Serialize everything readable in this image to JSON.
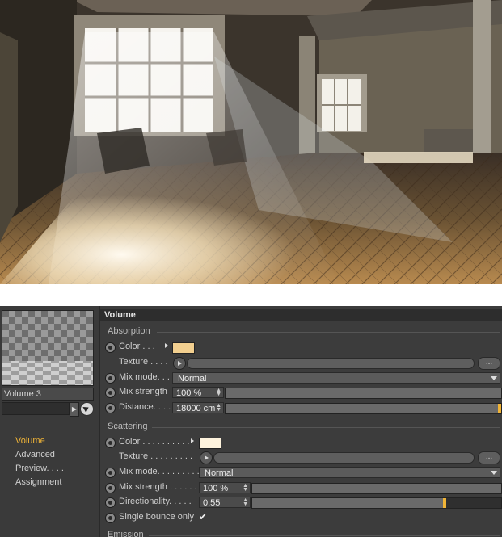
{
  "panel": {
    "material_name": "Volume 3",
    "nav": [
      "Volume",
      "Advanced",
      "Preview. . . .",
      "Assignment"
    ],
    "header": "Volume",
    "absorption": {
      "title": "Absorption",
      "color_label": "Color . . .",
      "color_hex": "#f2cf8f",
      "texture_label": "Texture . . . .",
      "texture_more": "...",
      "mix_mode_label": "Mix mode. . . .",
      "mix_mode_value": "Normal",
      "mix_strength_label": "Mix strength",
      "mix_strength_value": "100 %",
      "mix_strength_level": 1.0,
      "distance_label": "Distance. . . .",
      "distance_value": "18000 cm",
      "distance_level": 1.0
    },
    "scattering": {
      "title": "Scattering",
      "color_label": "Color . . . . . . . . . .",
      "color_hex": "#fdf2dc",
      "texture_label": "Texture . . . . . . . . .",
      "texture_more": "...",
      "mix_mode_label": "Mix mode. . . . . . . . .",
      "mix_mode_value": "Normal",
      "mix_strength_label": "Mix strength . . . . . .",
      "mix_strength_value": "100 %",
      "mix_strength_level": 1.0,
      "directionality_label": "Directionality. . . . .",
      "directionality_value": "0.55",
      "directionality_level": 0.78,
      "single_bounce_label": "Single bounce only",
      "single_bounce_mark": "✔"
    },
    "emission_title": "Emission",
    "accent_color": "#f0b437"
  }
}
